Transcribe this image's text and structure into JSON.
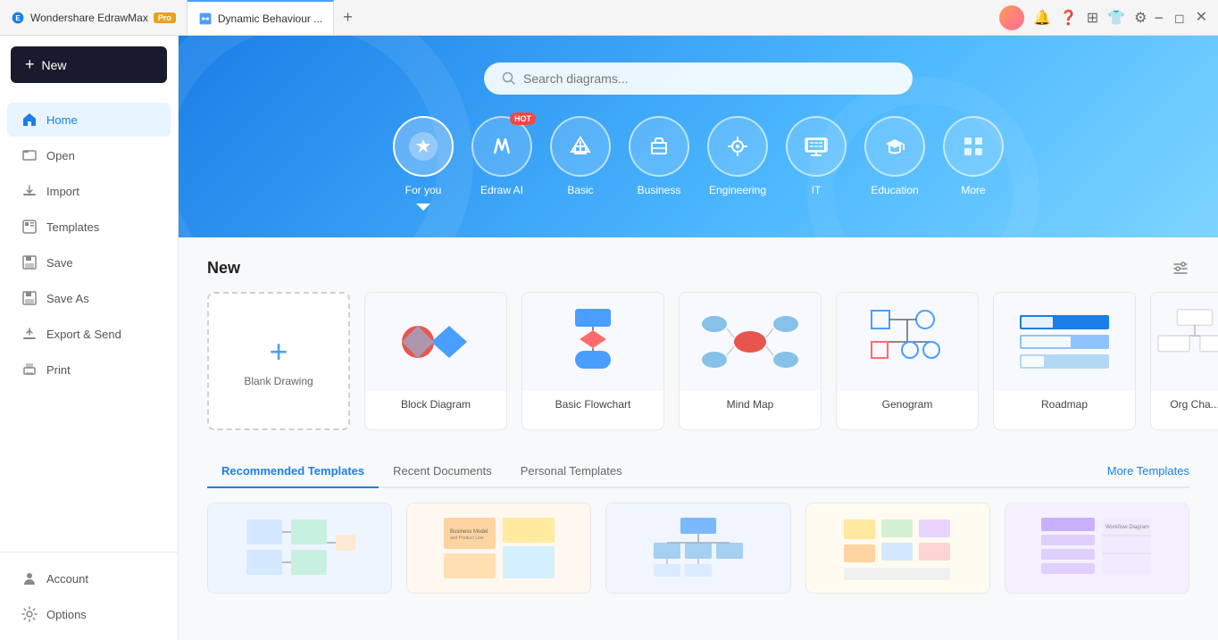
{
  "app": {
    "name": "Wondershare EdrawMax",
    "badge": "Pro"
  },
  "titlebar": {
    "tabs": [
      {
        "label": "Wondershare EdrawMax",
        "active": false,
        "icon": "edraw"
      },
      {
        "label": "Dynamic Behaviour ...",
        "active": true,
        "icon": "diagram"
      }
    ],
    "add_tab_label": "+"
  },
  "sidebar": {
    "new_button_label": "New",
    "nav_items": [
      {
        "id": "home",
        "label": "Home",
        "active": true
      },
      {
        "id": "open",
        "label": "Open",
        "active": false
      },
      {
        "id": "import",
        "label": "Import",
        "active": false
      },
      {
        "id": "templates",
        "label": "Templates",
        "active": false
      },
      {
        "id": "save",
        "label": "Save",
        "active": false
      },
      {
        "id": "save-as",
        "label": "Save As",
        "active": false
      },
      {
        "id": "export-send",
        "label": "Export & Send",
        "active": false
      },
      {
        "id": "print",
        "label": "Print",
        "active": false
      }
    ],
    "bottom_items": [
      {
        "id": "account",
        "label": "Account"
      },
      {
        "id": "options",
        "label": "Options"
      }
    ]
  },
  "banner": {
    "search_placeholder": "Search diagrams..."
  },
  "categories": [
    {
      "id": "for-you",
      "label": "For you",
      "active": true,
      "icon": "✦"
    },
    {
      "id": "edraw-ai",
      "label": "Edraw AI",
      "active": false,
      "icon": "✏",
      "hot": true
    },
    {
      "id": "basic",
      "label": "Basic",
      "active": false,
      "icon": "◆"
    },
    {
      "id": "business",
      "label": "Business",
      "active": false,
      "icon": "💼"
    },
    {
      "id": "engineering",
      "label": "Engineering",
      "active": false,
      "icon": "⚙"
    },
    {
      "id": "it",
      "label": "IT",
      "active": false,
      "icon": "▦"
    },
    {
      "id": "education",
      "label": "Education",
      "active": false,
      "icon": "🎓"
    },
    {
      "id": "more",
      "label": "More",
      "active": false,
      "icon": "⋯"
    }
  ],
  "new_section": {
    "title": "New",
    "blank_drawing_label": "Blank Drawing",
    "templates": [
      {
        "id": "block-diagram",
        "label": "Block Diagram"
      },
      {
        "id": "basic-flowchart",
        "label": "Basic Flowchart"
      },
      {
        "id": "mind-map",
        "label": "Mind Map"
      },
      {
        "id": "genogram",
        "label": "Genogram"
      },
      {
        "id": "roadmap",
        "label": "Roadmap"
      },
      {
        "id": "org-chart",
        "label": "Org Cha..."
      }
    ]
  },
  "recommended_section": {
    "tabs": [
      {
        "id": "recommended",
        "label": "Recommended Templates",
        "active": true
      },
      {
        "id": "recent",
        "label": "Recent Documents",
        "active": false
      },
      {
        "id": "personal",
        "label": "Personal Templates",
        "active": false
      }
    ],
    "more_label": "More Templates"
  },
  "colors": {
    "accent": "#1a7fe8",
    "banner_start": "#1a7fe8",
    "banner_end": "#7dd4ff",
    "sidebar_bg": "#ffffff",
    "new_btn_bg": "#1a1a2e"
  }
}
